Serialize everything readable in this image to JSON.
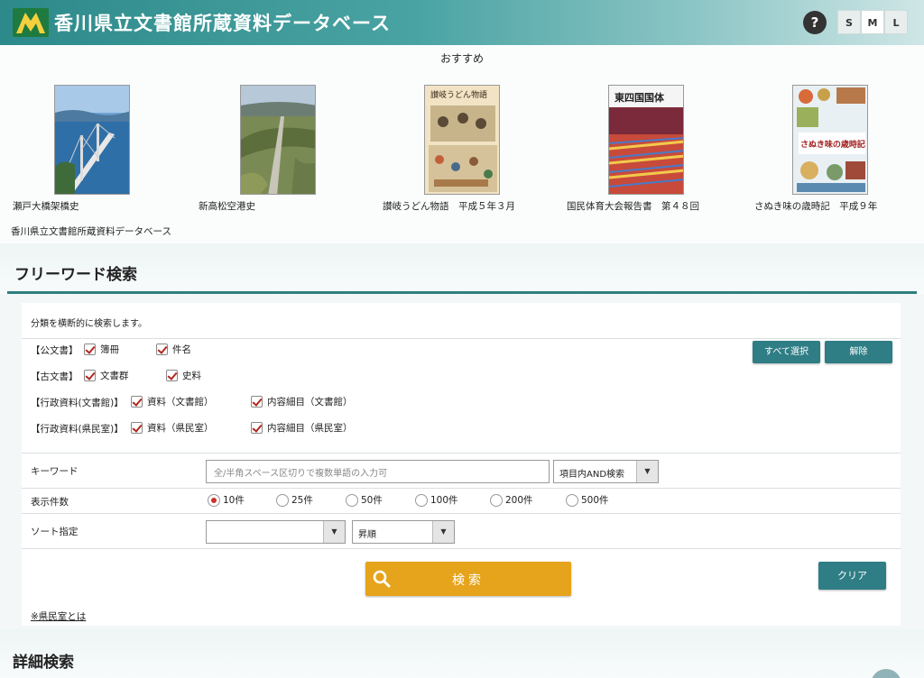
{
  "header": {
    "title": "香川県立文書館所蔵資料データベース",
    "help_label": "?",
    "sizes": [
      "S",
      "M",
      "L"
    ],
    "active_size": "M"
  },
  "recommend": {
    "title": "おすすめ",
    "items": [
      {
        "caption": "瀬戸大橋架橋史"
      },
      {
        "caption": "新高松空港史"
      },
      {
        "caption": "讃岐うどん物語　平成５年３月"
      },
      {
        "caption": "国民体育大会報告書　第４８回"
      },
      {
        "caption": "さぬき味の歳時記　平成９年"
      }
    ],
    "book_cover_texts": [
      "讃岐うどん物語",
      "東四国国体",
      "さぬき味の歳時記"
    ],
    "footer": "香川県立文書館所蔵資料データベース"
  },
  "free_search": {
    "heading": "フリーワード検索",
    "description": "分類を横断的に検索します。",
    "categories": [
      {
        "label": "【公文書】",
        "options": [
          "簿冊",
          "件名"
        ]
      },
      {
        "label": "【古文書】",
        "options": [
          "文書群",
          "史料"
        ]
      },
      {
        "label": "【行政資料(文書館)】",
        "options": [
          "資料（文書館）",
          "内容細目（文書館）"
        ]
      },
      {
        "label": "【行政資料(県民室)】",
        "options": [
          "資料（県民室）",
          "内容細目（県民室）"
        ]
      }
    ],
    "select_all_label": "すべて選択",
    "clear_selection_label": "解除",
    "keyword_label": "キーワード",
    "keyword_placeholder": "全/半角スペース区切りで複数単語の入力可",
    "keyword_mode": "項目内AND検索",
    "count_label": "表示件数",
    "count_options": [
      "10件",
      "25件",
      "50件",
      "100件",
      "200件",
      "500件"
    ],
    "count_selected": "10件",
    "sort_label": "ソート指定",
    "sort_field": "",
    "sort_order": "昇順",
    "search_label": "検索",
    "clear_label": "クリア",
    "note_link": "※県民室とは"
  },
  "detail_search": {
    "heading": "詳細検索"
  },
  "colors": {
    "header_teal": "#2d8a8a",
    "accent_rule": "#2f7f7f",
    "button_teal": "#2f7d85",
    "search_orange": "#e6a41c",
    "check_red": "#b3261e"
  }
}
